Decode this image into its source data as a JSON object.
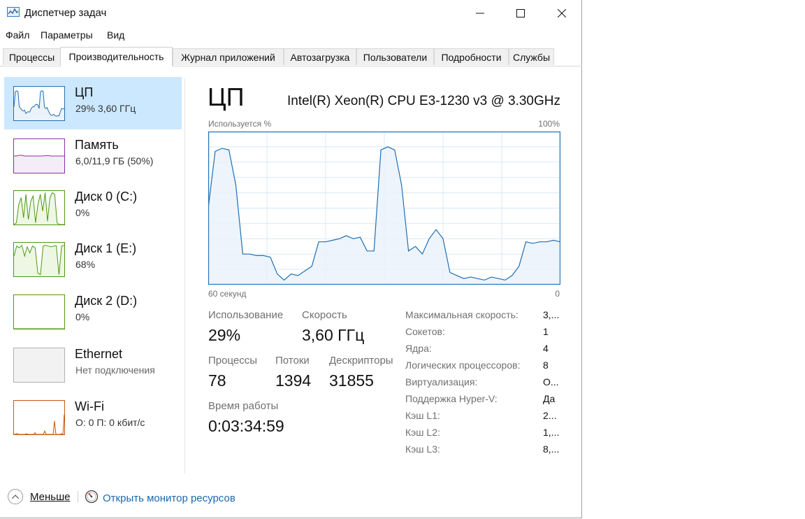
{
  "window": {
    "title": "Диспетчер задач",
    "controls": {
      "minimize": "—",
      "maximize": "☐",
      "close": "✕"
    }
  },
  "menu": [
    "Файл",
    "Параметры",
    "Вид"
  ],
  "tabs": [
    {
      "label": "Процессы",
      "active": false
    },
    {
      "label": "Производительность",
      "active": true
    },
    {
      "label": "Журнал приложений",
      "active": false
    },
    {
      "label": "Автозагрузка",
      "active": false
    },
    {
      "label": "Пользователи",
      "active": false
    },
    {
      "label": "Подробности",
      "active": false
    },
    {
      "label": "Службы",
      "active": false
    }
  ],
  "sidebar": [
    {
      "title": "ЦП",
      "subtitle": "29% 3,60 ГГц",
      "selected": true,
      "color": "#1e6fb5",
      "fill": "#eaf3fa",
      "series": [
        40,
        85,
        88,
        86,
        40,
        35,
        30,
        28,
        30,
        20,
        25,
        25,
        25,
        35,
        40,
        40,
        45,
        48,
        46,
        35,
        85,
        88,
        87,
        40,
        35,
        38,
        28,
        20,
        15,
        15,
        18,
        14,
        12,
        14,
        13,
        25,
        35,
        34,
        35
      ]
    },
    {
      "title": "Память",
      "subtitle": "6,0/11,9 ГБ (50%)",
      "selected": false,
      "color": "#8b2fa8",
      "fill": "#f4ecf7",
      "series": [
        50,
        50,
        52,
        52,
        50,
        50,
        50,
        50,
        50,
        50,
        50,
        50,
        51,
        51,
        50,
        50,
        50,
        50,
        50,
        50
      ]
    },
    {
      "title": "Диск 0 (C:)",
      "subtitle": "0%",
      "selected": false,
      "color": "#4d9a10",
      "fill": "#eef6e4",
      "series": [
        0,
        5,
        60,
        80,
        20,
        90,
        15,
        70,
        85,
        5,
        60,
        90,
        40,
        95,
        10,
        80,
        95,
        90,
        5,
        0,
        0,
        0
      ]
    },
    {
      "title": "Диск 1 (E:)",
      "subtitle": "68%",
      "selected": false,
      "color": "#4d9a10",
      "fill": "#eef6e4",
      "series": [
        60,
        90,
        85,
        92,
        60,
        88,
        70,
        90,
        85,
        10,
        5,
        90,
        92,
        90,
        88,
        90,
        91,
        5,
        90,
        92
      ]
    },
    {
      "title": "Диск 2 (D:)",
      "subtitle": "0%",
      "selected": false,
      "color": "#4d9a10",
      "fill": "#eef6e4",
      "series": [
        0,
        0,
        0,
        0,
        0,
        0
      ]
    },
    {
      "title": "Ethernet",
      "subtitle": "Нет подключения",
      "selected": false,
      "color": "#b0b0b0",
      "fill": "#f2f2f2",
      "series": []
    },
    {
      "title": "Wi-Fi",
      "subtitle": "О: 0 П: 0 кбит/с",
      "selected": false,
      "color": "#c55a11",
      "fill": "#fbf0e8",
      "series": [
        0,
        0,
        3,
        0,
        0,
        0,
        0,
        0,
        0,
        2,
        0,
        0,
        0,
        0,
        0,
        5,
        0,
        0,
        0,
        0,
        0,
        0,
        10,
        0,
        0,
        0,
        0,
        0,
        0,
        40,
        0,
        0,
        0,
        0,
        2,
        0,
        60
      ]
    }
  ],
  "main": {
    "title": "ЦП",
    "cpu_model": "Intel(R) Xeon(R) CPU E3-1230 v3 @ 3.30GHz",
    "graph_top_left": "Используется %",
    "graph_top_right": "100%",
    "graph_bottom_left": "60 секунд",
    "graph_bottom_right": "0",
    "utilization_label": "Использование",
    "utilization_value": "29%",
    "speed_label": "Скорость",
    "speed_value": "3,60 ГГц",
    "processes_label": "Процессы",
    "processes_value": "78",
    "threads_label": "Потоки",
    "threads_value": "1394",
    "handles_label": "Дескрипторы",
    "handles_value": "31855",
    "uptime_label": "Время работы",
    "uptime_value": "0:03:34:59",
    "specs": [
      {
        "label": "Максимальная скорость:",
        "value": "3,..."
      },
      {
        "label": "Сокетов:",
        "value": "1"
      },
      {
        "label": "Ядра:",
        "value": "4"
      },
      {
        "label": "Логических процессоров:",
        "value": "8"
      },
      {
        "label": "Виртуализация:",
        "value": "О..."
      },
      {
        "label": "Поддержка Hyper-V:",
        "value": "Да"
      },
      {
        "label": "Кэш L1:",
        "value": "2..."
      },
      {
        "label": "Кэш L2:",
        "value": "1,..."
      },
      {
        "label": "Кэш L3:",
        "value": "8,..."
      }
    ]
  },
  "chart_data": {
    "type": "area",
    "title": "",
    "ylabel": "Используется %",
    "ylim": [
      0,
      100
    ],
    "x_left_label": "60 секунд",
    "x_right_label": "0",
    "series": [
      {
        "values": [
          50,
          87,
          89,
          88,
          65,
          20,
          20,
          19,
          19,
          18,
          7,
          3,
          7,
          6,
          9,
          12,
          28,
          28,
          29,
          30,
          32,
          30,
          31,
          22,
          22,
          88,
          90,
          88,
          65,
          22,
          25,
          20,
          30,
          36,
          30,
          8,
          6,
          4,
          5,
          4,
          3,
          5,
          4,
          3,
          6,
          12,
          28,
          27,
          28,
          28,
          29,
          28
        ]
      }
    ]
  },
  "footer": {
    "less_label": "Меньше",
    "link_label": "Открыть монитор ресурсов"
  },
  "colors": {
    "accent": "#1e6fb5",
    "graph_fill": "#eaf2fa",
    "grid": "#d9e8f3",
    "selection": "#cce8ff",
    "link": "#1a68b0"
  }
}
